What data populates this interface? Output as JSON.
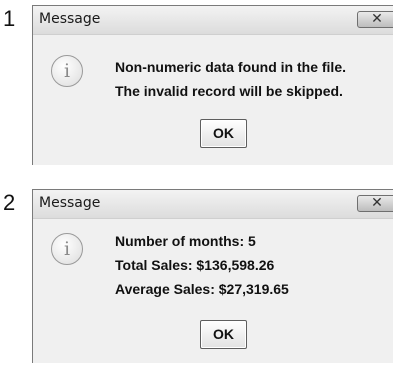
{
  "steps": [
    {
      "number": "1",
      "title": "Message",
      "close_label": "✕",
      "icon": "info-icon",
      "lines": [
        "Non-numeric data found in the file.",
        "The invalid record will be skipped."
      ],
      "ok_label": "OK"
    },
    {
      "number": "2",
      "title": "Message",
      "close_label": "✕",
      "icon": "info-icon",
      "lines": [
        "Number of months: 5",
        "Total Sales: $136,598.26",
        "Average Sales: $27,319.65"
      ],
      "ok_label": "OK"
    }
  ]
}
